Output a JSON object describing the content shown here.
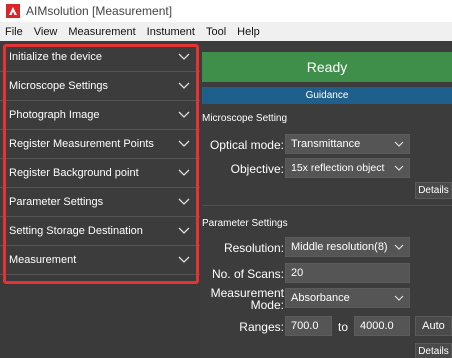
{
  "window": {
    "title": "AIMsolution [Measurement]"
  },
  "menu": [
    "File",
    "View",
    "Measurement",
    "Instument",
    "Tool",
    "Help"
  ],
  "sidebar": {
    "items": [
      {
        "label": "Initialize the device"
      },
      {
        "label": "Microscope Settings"
      },
      {
        "label": "Photograph Image"
      },
      {
        "label": "Register Measurement Points"
      },
      {
        "label": "Register Background point"
      },
      {
        "label": "Parameter Settings"
      },
      {
        "label": "Setting Storage Destination"
      },
      {
        "label": "Measurement"
      }
    ]
  },
  "main": {
    "status": "Ready",
    "guidance": "Guidance",
    "microscope": {
      "heading": "Microscope Setting",
      "optical_label": "Optical mode:",
      "optical_value": "Transmittance",
      "objective_label": "Objective:",
      "objective_value": "15x reflection object",
      "details": "Details"
    },
    "params": {
      "heading": "Parameter Settings",
      "resolution_label": "Resolution:",
      "resolution_value": "Middle resolution(8)",
      "scans_label": "No. of Scans:",
      "scans_value": "20",
      "mode_label_1": "Measurement",
      "mode_label_2": "Mode:",
      "mode_value": "Absorbance",
      "ranges_label": "Ranges:",
      "range_from": "700.0",
      "to_label": "to",
      "range_to": "4000.0",
      "auto": "Auto",
      "details": "Details"
    }
  },
  "colors": {
    "highlight": "#e53333",
    "ready": "#3f8f4a",
    "guidance": "#1f5f8c"
  }
}
